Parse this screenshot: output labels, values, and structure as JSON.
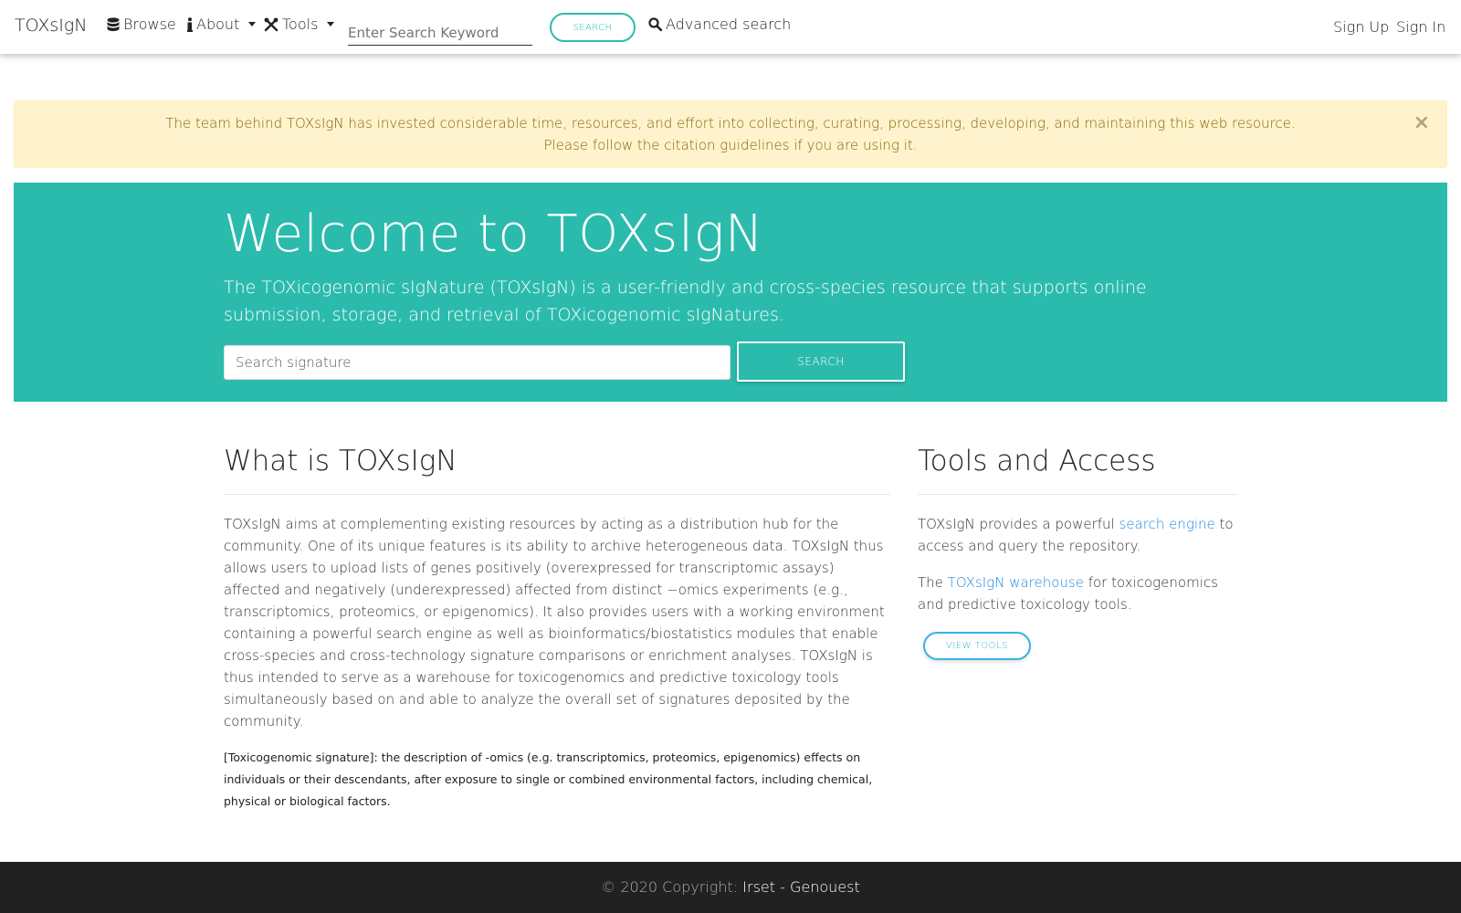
{
  "navbar": {
    "brand": "TOXsIgN",
    "browse_label": "Browse",
    "about_label": "About",
    "tools_label": "Tools",
    "search_placeholder": "Enter Search Keyword",
    "search_button": "SEARCH",
    "advanced_label": "Advanced search",
    "signup_label": "Sign Up",
    "signin_label": "Sign In",
    "icons": {
      "browse": "database-icon",
      "about": "info-icon",
      "tools": "wrench-icon",
      "advanced": "search-icon"
    }
  },
  "alert": {
    "line1": "The team behind TOXsIgN has invested considerable time, resources, and effort into collecting, curating, processing, developing, and maintaining this web resource.",
    "line2": "Please follow the citation guidelines if you are using it.",
    "close": "×"
  },
  "hero": {
    "title": "Welcome to TOXsIgN",
    "lead": "The TOXicogenomic sIgNature (TOXsIgN) is a user-friendly and cross-species resource that supports online submission, storage, and retrieval of TOXicogenomic sIgNatures.",
    "search_placeholder": "Search signature",
    "search_button": "SEARCH"
  },
  "what": {
    "title": "What is TOXsIgN",
    "body": "TOXsIgN aims at complementing existing resources by acting as a distribution hub for the community. One of its unique features is its ability to archive heterogeneous data. TOXsIgN thus allows users to upload lists of genes positively (overexpressed for transcriptomic assays) affected and negatively (underexpressed) affected from distinct −omics experiments (e.g., transcriptomics, proteomics, or epigenomics). It also provides users with a working environment containing a powerful search engine as well as bioinformatics/biostatistics modules that enable cross-species and cross-technology signature comparisons or enrichment analyses. TOXsIgN is thus intended to serve as a warehouse for toxicogenomics and predictive toxicology tools simultaneously based on and able to analyze the overall set of signatures deposited by the community.",
    "note": "[Toxicogenomic signature]: the description of -omics (e.g. transcriptomics, proteomics, epigenomics) effects on individuals or their descendants, after exposure to single or combined environmental factors, including chemical, physical or biological factors."
  },
  "tools": {
    "title": "Tools and Access",
    "p1_pre": "TOXsIgN provides a powerful ",
    "p1_link": "search engine",
    "p1_post": " to access and query the repository.",
    "p2_pre": "The ",
    "p2_link": "TOXsIgN warehouse",
    "p2_post": " for toxicogenomics and predictive toxicology tools.",
    "view_button": "VIEW TOOLS"
  },
  "footer": {
    "copyright": "© 2020 Copyright: ",
    "link1": "Irset",
    "sep": " - ",
    "link2": "Genouest"
  },
  "colors": {
    "hero_bg": "#2bbbad",
    "alert_bg": "#fff3cd",
    "alert_text": "#856404",
    "link": "#1e88e5",
    "footer_bg": "#212121"
  }
}
